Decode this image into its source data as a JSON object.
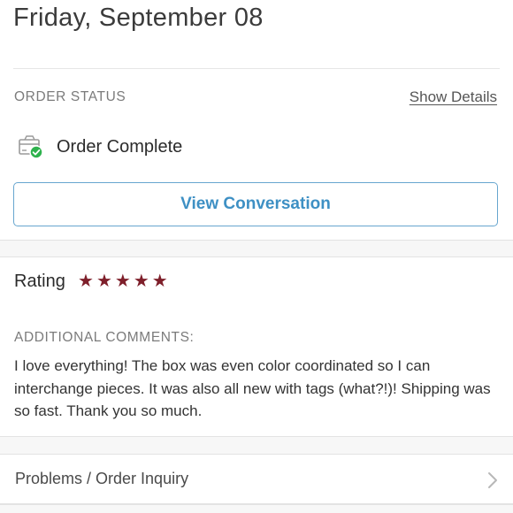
{
  "header": {
    "date": "Friday, September 08"
  },
  "order_status": {
    "section_label": "ORDER STATUS",
    "show_details_label": "Show Details",
    "status_text": "Order Complete",
    "status_icon": "package-check-icon",
    "view_conversation_label": "View Conversation"
  },
  "rating": {
    "label": "Rating",
    "stars": 5,
    "max_stars": 5,
    "star_color": "#7e1f2a"
  },
  "comments": {
    "section_label": "ADDITIONAL COMMENTS:",
    "text": "I love everything! The box was even color coordinated so I can interchange pieces. It was also all new with tags (what?!)! Shipping was so fast. Thank you so much."
  },
  "inquiry": {
    "label": "Problems / Order Inquiry",
    "icon": "chevron-right-icon"
  },
  "colors": {
    "accent": "#3e90c4",
    "accent_border": "#67a6cf",
    "success": "#2eb24d",
    "rating": "#7e1f2a"
  }
}
